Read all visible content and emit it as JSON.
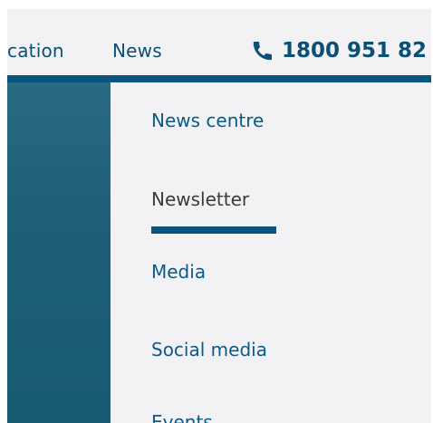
{
  "topnav": {
    "items": [
      "cation",
      "News"
    ],
    "phone": {
      "icon": "phone-icon",
      "number": "1800 951 82"
    }
  },
  "submenu": {
    "items": [
      {
        "label": "News centre",
        "active": false
      },
      {
        "label": "Newsletter",
        "active": true
      },
      {
        "label": "Media",
        "active": false
      },
      {
        "label": "Social media",
        "active": false
      },
      {
        "label": "Events",
        "active": false
      }
    ]
  },
  "colors": {
    "brand_dark": "#0a557d",
    "link": "#0b5b86",
    "background": "#f2f1f4",
    "left_panel": "#1f5f78",
    "active_text": "#3b3b3b"
  }
}
